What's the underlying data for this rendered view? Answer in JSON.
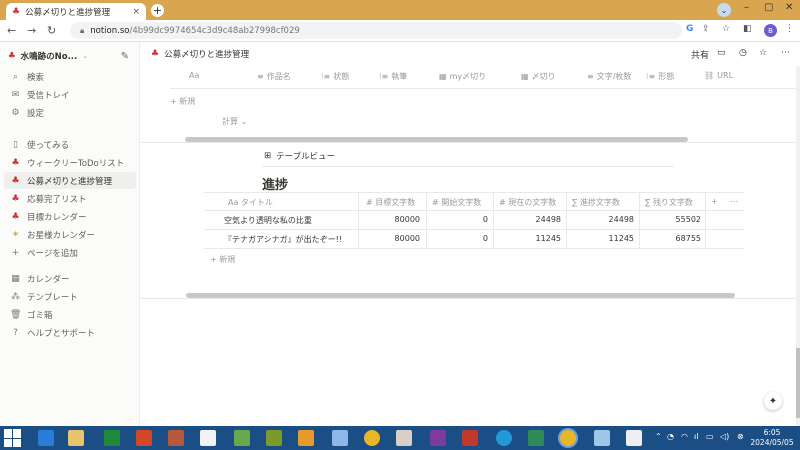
{
  "browser": {
    "tab_title": "公募〆切りと進捗管理",
    "tab_close": "×",
    "new_tab": "+",
    "url_host": "notion.so",
    "url_path": "/4b99dc9974654c3d9c48ab27998cf029",
    "profile_initial": "B",
    "accent": "#d9a54e"
  },
  "sidebar": {
    "workspace": "水鳴跡のNo...",
    "search": "検索",
    "inbox": "受信トレイ",
    "settings": "設定",
    "pages": [
      {
        "label": "使ってみる"
      },
      {
        "label": "ウィークリーToDoリスト"
      },
      {
        "label": "公募〆切りと進捗管理"
      },
      {
        "label": "応募完了リスト"
      },
      {
        "label": "目標カレンダー"
      },
      {
        "label": "お星様カレンダー"
      }
    ],
    "add_page": "ページを追加",
    "calendar": "カレンダー",
    "templates": "テンプレート",
    "trash": "ゴミ箱",
    "help": "ヘルプとサポート"
  },
  "header": {
    "breadcrumb": "公募〆切りと進捗管理",
    "share": "共有"
  },
  "top_table": {
    "columns": [
      "Aa",
      "作品名",
      "状態",
      "執筆",
      "my〆切り",
      "〆切り",
      "文字/枚数",
      "形態",
      "URL"
    ],
    "new_row": "新規",
    "calc": "計算"
  },
  "progress_view": {
    "view_tab": "テーブルビュー",
    "title": "進捗",
    "columns": [
      "タイトル",
      "目標文字数",
      "開始文字数",
      "現在の文字数",
      "進捗文字数",
      "残り文字数"
    ],
    "rows": [
      {
        "title": "空気より透明な私の比重",
        "target": "80000",
        "start": "0",
        "current": "24498",
        "progress": "24498",
        "remaining": "55502"
      },
      {
        "title": "『テナガアシナガ』が出たぞー!!",
        "target": "80000",
        "start": "0",
        "current": "11245",
        "progress": "11245",
        "remaining": "68755"
      }
    ],
    "new_row": "新規"
  },
  "taskbar": {
    "time": "6:05",
    "date": "2024/05/05"
  }
}
